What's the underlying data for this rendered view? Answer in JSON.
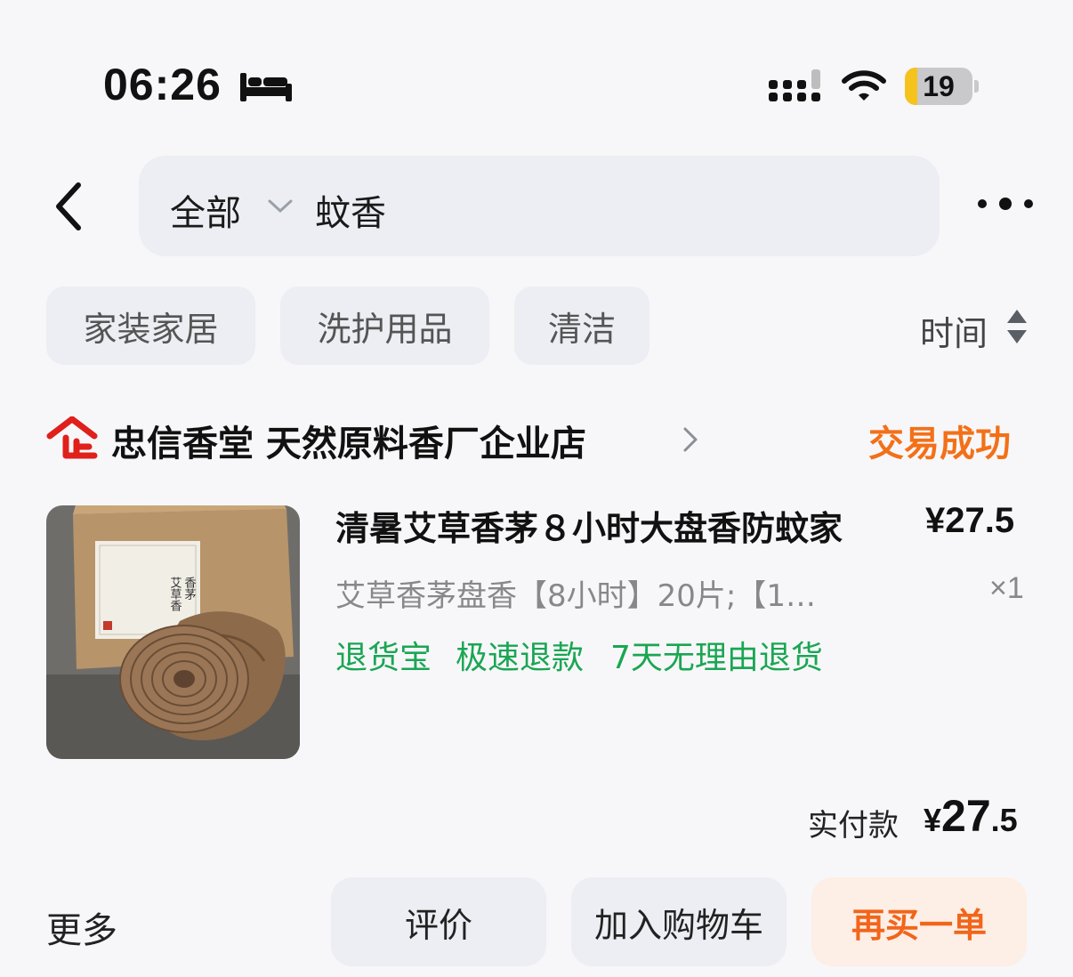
{
  "status_bar": {
    "time": "06:26",
    "battery_level": "19",
    "battery_fill_fraction": 0.19,
    "icons": [
      "bed-icon",
      "signal-icon",
      "wifi-icon",
      "battery-icon"
    ]
  },
  "header": {
    "back_icon": "chevron-left-icon",
    "search_scope": "全部",
    "search_query": "蚊香",
    "more_icon": "more-dots-icon"
  },
  "filters": {
    "chips": [
      "家装家居",
      "洗护用品",
      "清洁"
    ],
    "sort_label": "时间"
  },
  "order": {
    "shop": {
      "badge_text": "企",
      "name": "忠信香堂 天然原料香厂企业店"
    },
    "status": "交易成功",
    "product": {
      "title": "清暑艾草香茅８小时大盘香防蚊家",
      "price": "¥27.5",
      "sku": "艾草香茅盘香【8小时】20片;【1…",
      "quantity": "×1",
      "box_label": "香茅艾草香"
    },
    "service_tags": [
      "退货宝",
      "极速退款",
      "7天无理由退货"
    ],
    "paid": {
      "label": "实付款",
      "currency": "¥",
      "integer": "27",
      "decimal": ".5"
    }
  },
  "actions": {
    "more": "更多",
    "review": "评价",
    "add_to_cart": "加入购物车",
    "rebuy": "再买一单"
  },
  "colors": {
    "accent_orange": "#f37018",
    "service_green": "#1aa653",
    "shop_badge_red": "#e0201b",
    "battery_yellow": "#f6c21c"
  }
}
